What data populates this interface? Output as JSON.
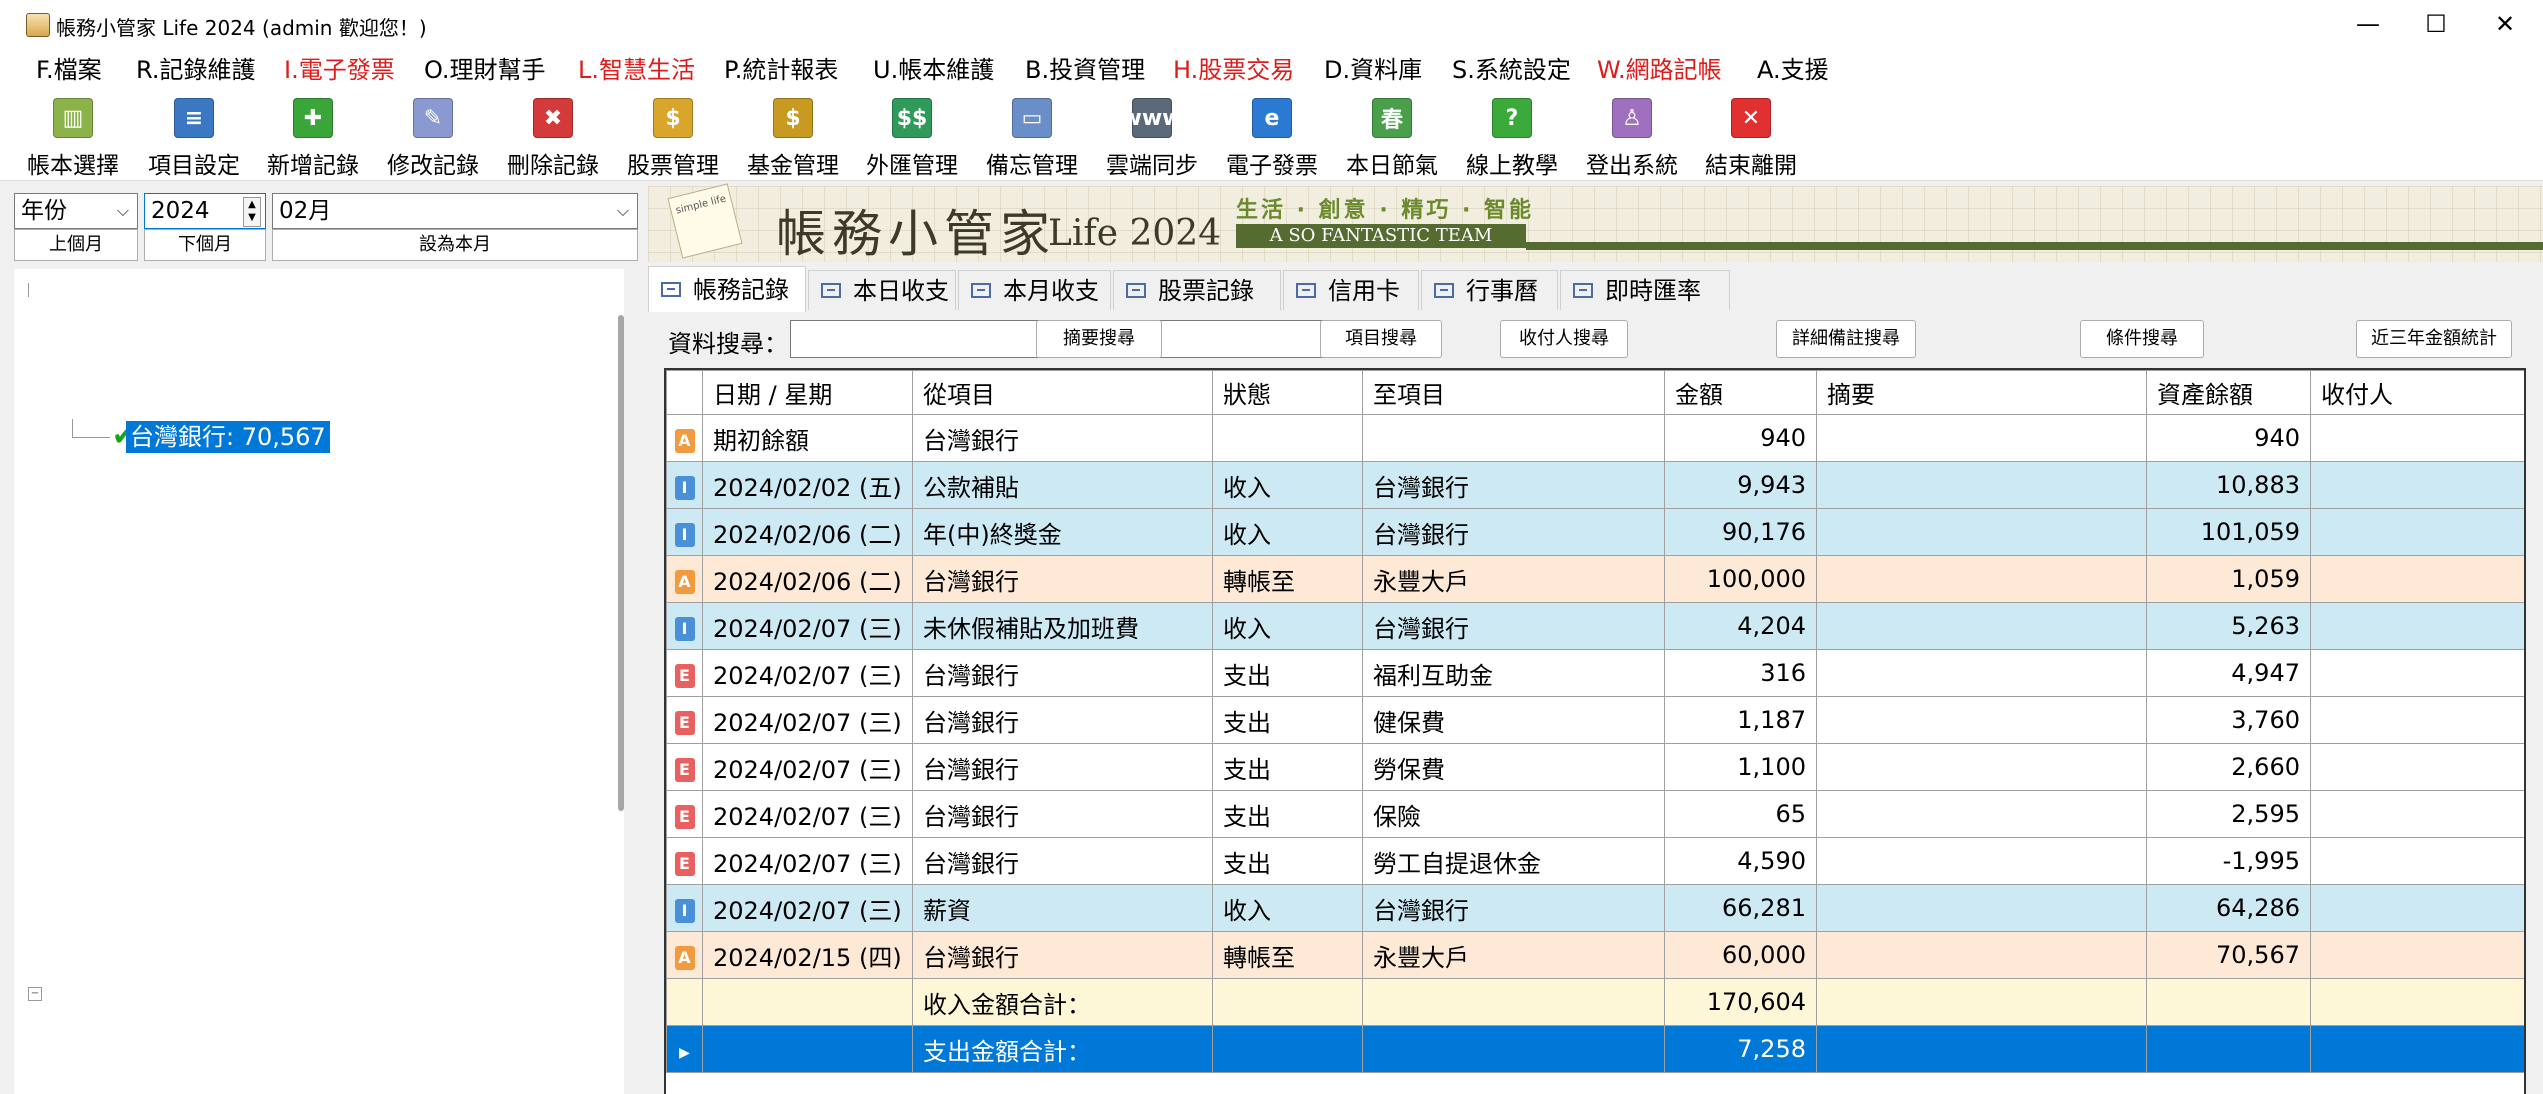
{
  "window": {
    "title": "帳務小管家 Life 2024 (admin 歡迎您！)",
    "minimize": "—",
    "maximize": "☐",
    "close": "✕"
  },
  "menu": [
    {
      "label": "F.檔案",
      "color": "#000000"
    },
    {
      "label": "R.記錄維護",
      "color": "#000000"
    },
    {
      "label": "I.電子發票",
      "color": "#e01b1b"
    },
    {
      "label": "O.理財幫手",
      "color": "#000000"
    },
    {
      "label": "L.智慧生活",
      "color": "#e01b1b"
    },
    {
      "label": "P.統計報表",
      "color": "#000000"
    },
    {
      "label": "U.帳本維護",
      "color": "#000000"
    },
    {
      "label": "B.投資管理",
      "color": "#000000"
    },
    {
      "label": "H.股票交易",
      "color": "#e01b1b"
    },
    {
      "label": "D.資料庫",
      "color": "#000000"
    },
    {
      "label": "S.系統設定",
      "color": "#000000"
    },
    {
      "label": "W.網路記帳",
      "color": "#e01b1b"
    },
    {
      "label": "A.支援",
      "color": "#000000"
    }
  ],
  "toolbar": [
    {
      "label": "帳本選擇",
      "icon": "books-icon",
      "glyph": "▥",
      "color": "#8bb34a"
    },
    {
      "label": "項目設定",
      "icon": "ledger-sheet-icon",
      "glyph": "≡",
      "color": "#3b78c4"
    },
    {
      "label": "新增記錄",
      "icon": "add-record-icon",
      "glyph": "✚",
      "color": "#3aa63a"
    },
    {
      "label": "修改記錄",
      "icon": "eraser-icon",
      "glyph": "✎",
      "color": "#8a9ad0"
    },
    {
      "label": "刪除記錄",
      "icon": "delete-record-icon",
      "glyph": "✖",
      "color": "#d43a3a"
    },
    {
      "label": "股票管理",
      "icon": "stock-coins-icon",
      "glyph": "$",
      "color": "#d9a52a"
    },
    {
      "label": "基金管理",
      "icon": "fund-coins-icon",
      "glyph": "$",
      "color": "#c99a22"
    },
    {
      "label": "外匯管理",
      "icon": "forex-icon",
      "glyph": "$$",
      "color": "#2f9a5a"
    },
    {
      "label": "備忘管理",
      "icon": "monitor-icon",
      "glyph": "▭",
      "color": "#6a8fc8"
    },
    {
      "label": "雲端同步",
      "icon": "cloud-sync-icon",
      "glyph": "www",
      "color": "#5a6a7a"
    },
    {
      "label": "電子發票",
      "icon": "e-invoice-icon",
      "glyph": "e",
      "color": "#2a7ad4"
    },
    {
      "label": "本日節氣",
      "icon": "solar-term-icon",
      "glyph": "春",
      "color": "#4aa04a"
    },
    {
      "label": "線上教學",
      "icon": "help-icon",
      "glyph": "?",
      "color": "#3aaa3a"
    },
    {
      "label": "登出系統",
      "icon": "users-logout-icon",
      "glyph": "♙",
      "color": "#a070c0"
    },
    {
      "label": "結束離開",
      "icon": "exit-icon",
      "glyph": "✕",
      "color": "#e03030"
    }
  ],
  "filter": {
    "period_type": "年份",
    "year": "2024",
    "month": "02月",
    "prev_month": "上個月",
    "next_month": "下個月",
    "set_this_month": "設為本月"
  },
  "tree": {
    "selected_node": "台灣銀行: 70,567"
  },
  "banner": {
    "title": "帳務小管家",
    "subtitle": "Life 2024",
    "slogan": "生活 · 創意 · 精巧 · 智能",
    "team": "A SO FANTASTIC TEAM",
    "note": "simple life"
  },
  "tabs": [
    "帳務記錄",
    "本日收支",
    "本月收支",
    "股票記錄",
    "信用卡",
    "行事曆",
    "即時匯率"
  ],
  "search": {
    "label": "資料搜尋：",
    "value": "",
    "buttons": [
      "摘要搜尋",
      "項目搜尋",
      "收付人搜尋",
      "詳細備註搜尋",
      "條件搜尋",
      "近三年金額統計"
    ]
  },
  "grid": {
    "headers": [
      "",
      "日期 / 星期",
      "從項目",
      "狀態",
      "至項目",
      "金額",
      "摘要",
      "資產餘額",
      "收付人"
    ],
    "rows": [
      {
        "type": "A",
        "date": "期初餘額",
        "from": "台灣銀行",
        "status": "",
        "to": "",
        "amount": "940",
        "memo": "",
        "balance": "940",
        "payee": "",
        "first": true
      },
      {
        "type": "I",
        "date": "2024/02/02 (五)",
        "from": "公款補貼",
        "status": "收入",
        "to": "台灣銀行",
        "amount": "9,943",
        "memo": "",
        "balance": "10,883",
        "payee": ""
      },
      {
        "type": "I",
        "date": "2024/02/06 (二)",
        "from": "年(中)終獎金",
        "status": "收入",
        "to": "台灣銀行",
        "amount": "90,176",
        "memo": "",
        "balance": "101,059",
        "payee": ""
      },
      {
        "type": "A",
        "date": "2024/02/06 (二)",
        "from": "台灣銀行",
        "status": "轉帳至",
        "to": "永豐大戶",
        "amount": "100,000",
        "memo": "",
        "balance": "1,059",
        "payee": ""
      },
      {
        "type": "I",
        "date": "2024/02/07 (三)",
        "from": "未休假補貼及加班費",
        "status": "收入",
        "to": "台灣銀行",
        "amount": "4,204",
        "memo": "",
        "balance": "5,263",
        "payee": ""
      },
      {
        "type": "E",
        "date": "2024/02/07 (三)",
        "from": "台灣銀行",
        "status": "支出",
        "to": "福利互助金",
        "amount": "316",
        "memo": "",
        "balance": "4,947",
        "payee": ""
      },
      {
        "type": "E",
        "date": "2024/02/07 (三)",
        "from": "台灣銀行",
        "status": "支出",
        "to": "健保費",
        "amount": "1,187",
        "memo": "",
        "balance": "3,760",
        "payee": ""
      },
      {
        "type": "E",
        "date": "2024/02/07 (三)",
        "from": "台灣銀行",
        "status": "支出",
        "to": "勞保費",
        "amount": "1,100",
        "memo": "",
        "balance": "2,660",
        "payee": ""
      },
      {
        "type": "E",
        "date": "2024/02/07 (三)",
        "from": "台灣銀行",
        "status": "支出",
        "to": "保險",
        "amount": "65",
        "memo": "",
        "balance": "2,595",
        "payee": ""
      },
      {
        "type": "E",
        "date": "2024/02/07 (三)",
        "from": "台灣銀行",
        "status": "支出",
        "to": "勞工自提退休金",
        "amount": "4,590",
        "memo": "",
        "balance": "-1,995",
        "payee": ""
      },
      {
        "type": "I",
        "date": "2024/02/07 (三)",
        "from": "薪資",
        "status": "收入",
        "to": "台灣銀行",
        "amount": "66,281",
        "memo": "",
        "balance": "64,286",
        "payee": ""
      },
      {
        "type": "A",
        "date": "2024/02/15 (四)",
        "from": "台灣銀行",
        "status": "轉帳至",
        "to": "永豐大戶",
        "amount": "60,000",
        "memo": "",
        "balance": "70,567",
        "payee": ""
      }
    ],
    "summary": [
      {
        "label": "收入金額合計：",
        "amount": "170,604",
        "selected": false
      },
      {
        "label": "支出金額合計：",
        "amount": "7,258",
        "selected": true
      }
    ]
  }
}
